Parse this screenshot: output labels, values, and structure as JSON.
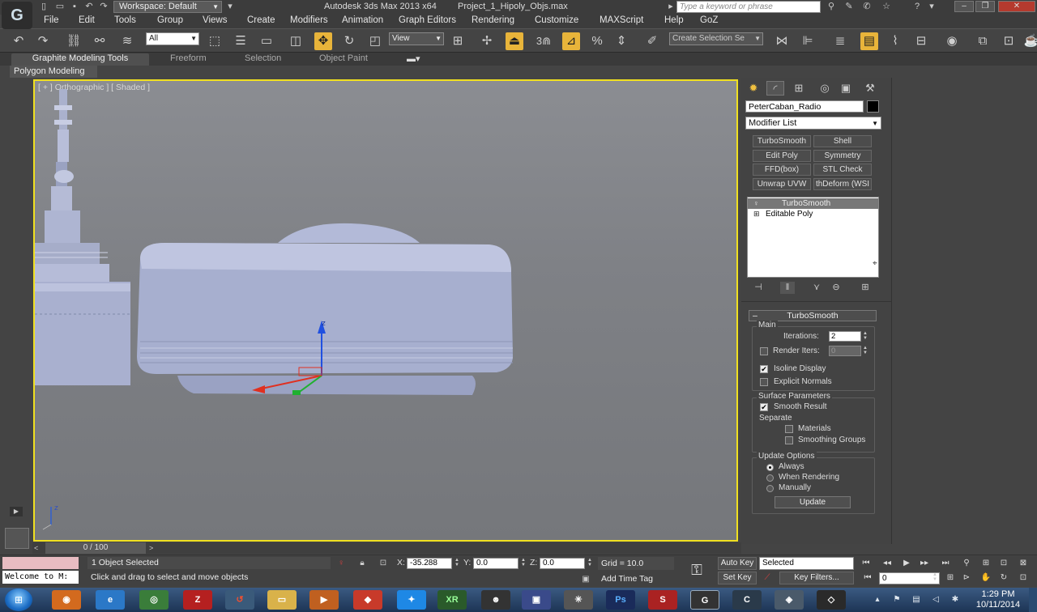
{
  "titlebar": {
    "workspace": "Workspace: Default",
    "app_title": "Autodesk 3ds Max  2013 x64",
    "file_title": "Project_1_Hipoly_Objs.max",
    "search_placeholder": "Type a keyword or phrase"
  },
  "menu": [
    "File",
    "Edit",
    "Tools",
    "Group",
    "Views",
    "Create",
    "Modifiers",
    "Animation",
    "Graph Editors",
    "Rendering",
    "Customize",
    "MAXScript",
    "Help",
    "GoZ"
  ],
  "toolbar": {
    "selection_filter": "All",
    "ref_coord": "View",
    "snap_label": "3",
    "named_selection_placeholder": "Create Selection Se"
  },
  "ribbon": {
    "tabs": [
      "Graphite Modeling Tools",
      "Freeform",
      "Selection",
      "Object Paint"
    ],
    "sub_label": "Polygon Modeling"
  },
  "viewport": {
    "label": "[ + ] Orthographic ] [ Shaded ]",
    "gizmo_z": "z",
    "corner_axis_z": "z"
  },
  "command_panel": {
    "object_name": "PeterCaban_Radio",
    "object_color": "#000000",
    "modifier_list": "Modifier List",
    "modifier_buttons": [
      "TurboSmooth",
      "Shell",
      "Edit Poly",
      "Symmetry",
      "FFD(box)",
      "STL Check",
      "Unwrap UVW",
      "thDeform (WSI"
    ],
    "stack": [
      "TurboSmooth",
      "Editable Poly"
    ],
    "rollout": {
      "title": "TurboSmooth",
      "main_group": "Main",
      "iterations_label": "Iterations:",
      "iterations_value": "2",
      "render_iters_label": "Render Iters:",
      "render_iters_value": "0",
      "render_iters_checked": false,
      "isoline_label": "Isoline Display",
      "isoline_checked": true,
      "explicit_normals_label": "Explicit Normals",
      "explicit_normals_checked": false,
      "surface_group": "Surface Parameters",
      "smooth_result_label": "Smooth Result",
      "smooth_result_checked": true,
      "separate_label": "Separate",
      "materials_label": "Materials",
      "smoothing_groups_label": "Smoothing Groups",
      "update_group": "Update Options",
      "update_options": [
        "Always",
        "When Rendering",
        "Manually"
      ],
      "update_selected": "Always",
      "update_button": "Update"
    }
  },
  "timeline": {
    "frame_readout": "0 / 100"
  },
  "status": {
    "listener_text": "Welcome to M:",
    "selection_count": "1 Object Selected",
    "prompt": "Click and drag to select and move objects",
    "x_label": "X:",
    "x_value": "-35.288",
    "y_label": "Y:",
    "y_value": "0.0",
    "z_label": "Z:",
    "z_value": "0.0",
    "grid": "Grid = 10.0",
    "add_time_tag": "Add Time Tag",
    "auto_key": "Auto Key",
    "set_key": "Set Key",
    "key_mode": "Selected",
    "key_filters": "Key Filters...",
    "current_frame": "0"
  },
  "taskbar": {
    "time": "1:29 PM",
    "date": "10/11/2014"
  },
  "colors": {
    "viewport_border": "#f0e020",
    "active_tool": "#e8b43a",
    "model": "#a7afcf"
  }
}
